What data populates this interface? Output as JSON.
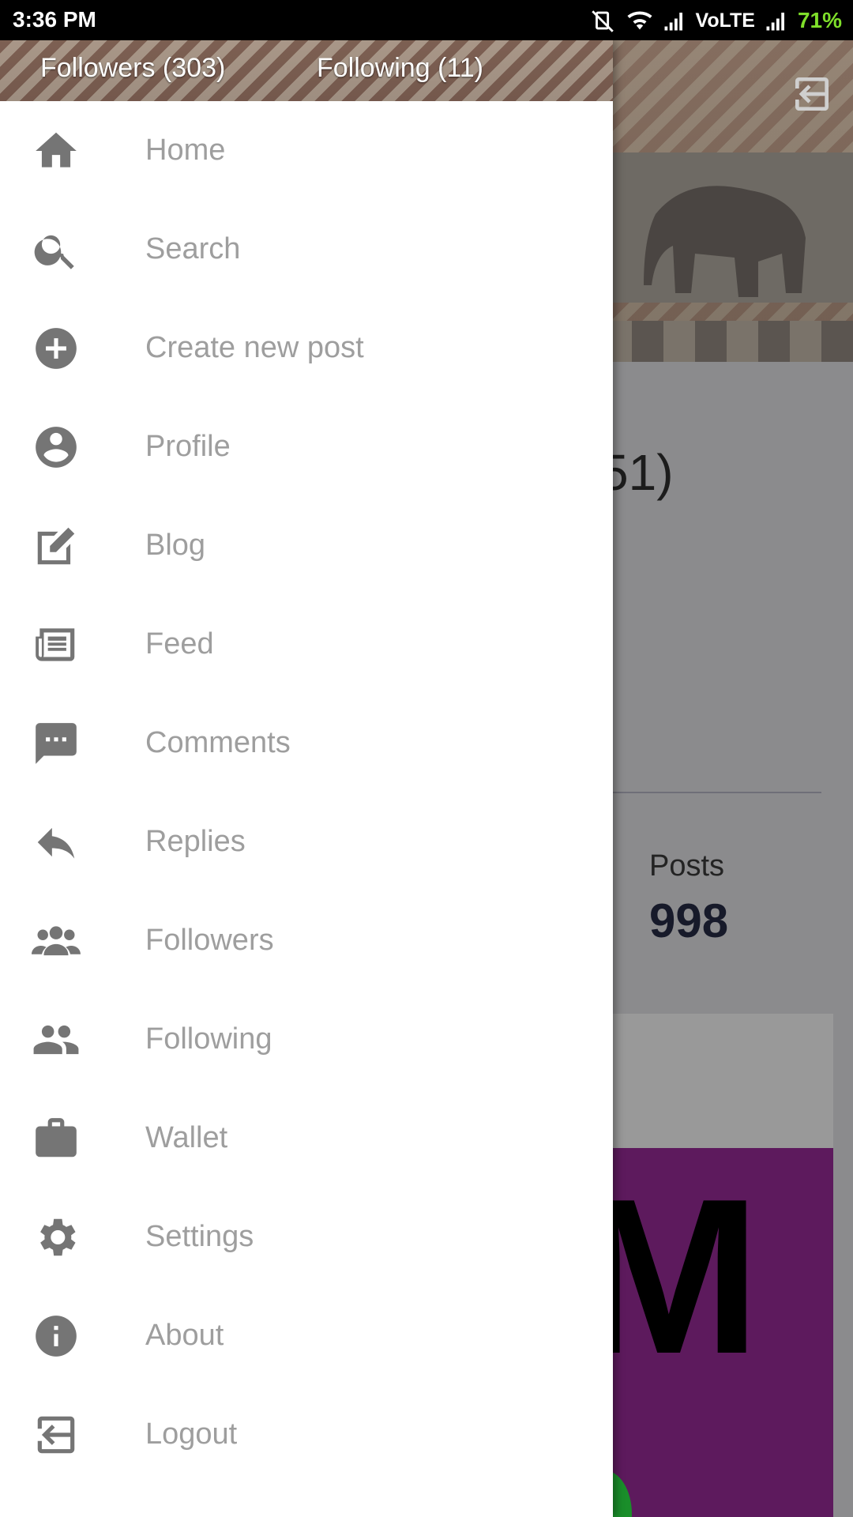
{
  "status_bar": {
    "time": "3:36 PM",
    "network": "VoLTE",
    "battery": "71%",
    "battery_color": "#7fdf2a"
  },
  "drawer_header": {
    "followers": "Followers (303)",
    "following": "Following (11)"
  },
  "menu": [
    {
      "label": "Home",
      "icon": "home-icon"
    },
    {
      "label": "Search",
      "icon": "search-icon"
    },
    {
      "label": "Create new post",
      "icon": "add-circle-icon"
    },
    {
      "label": "Profile",
      "icon": "account-circle-icon"
    },
    {
      "label": "Blog",
      "icon": "edit-icon"
    },
    {
      "label": "Feed",
      "icon": "newspaper-icon"
    },
    {
      "label": "Comments",
      "icon": "comment-icon"
    },
    {
      "label": "Replies",
      "icon": "reply-icon"
    },
    {
      "label": "Followers",
      "icon": "followers-icon"
    },
    {
      "label": "Following",
      "icon": "following-icon"
    },
    {
      "label": "Wallet",
      "icon": "wallet-icon"
    },
    {
      "label": "Settings",
      "icon": "settings-icon"
    },
    {
      "label": "About",
      "icon": "info-icon"
    },
    {
      "label": "Logout",
      "icon": "logout-icon"
    }
  ],
  "background": {
    "name_fragment": "51)",
    "posts_label": "Posts",
    "posts_value": "998",
    "card_letter": "M"
  },
  "colors": {
    "menu_icon": "#757575",
    "menu_text": "#9e9e9e",
    "scrim": "#8a8a8a"
  }
}
